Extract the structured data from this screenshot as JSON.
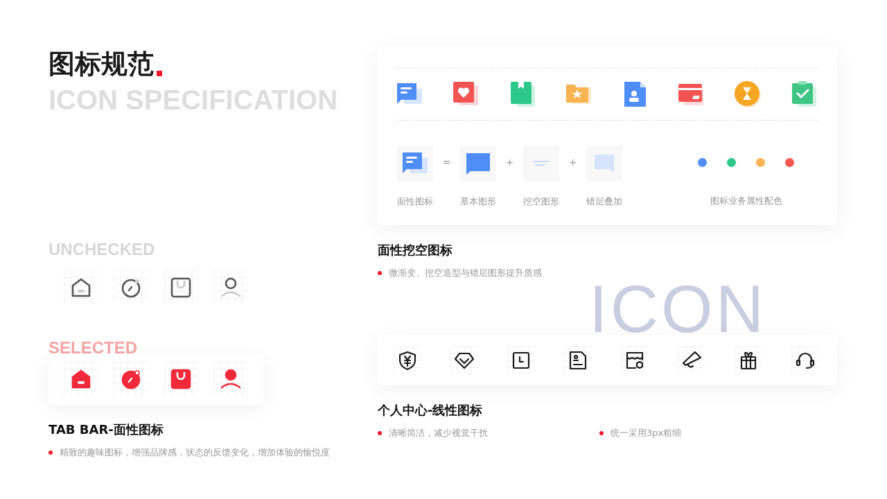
{
  "title": "图标规范",
  "title_subtitle": "ICON SPECIFICATION",
  "background_word": "ICON",
  "tabbar": {
    "rows": [
      {
        "label": "UNCHECKED",
        "selected": false
      },
      {
        "label": "SELECTED",
        "selected": true
      }
    ],
    "icons": [
      {
        "kind": "home"
      },
      {
        "kind": "compass"
      },
      {
        "kind": "bag"
      },
      {
        "kind": "user"
      }
    ],
    "heading": "TAB BAR-面性图标",
    "notes": [
      "精致的趣味图标，增强品牌感，状态的反馈变化，增加体验的愉悦度"
    ]
  },
  "face_icons": {
    "icons": [
      {
        "kind": "chat"
      },
      {
        "kind": "heart"
      },
      {
        "kind": "book"
      },
      {
        "kind": "folder"
      },
      {
        "kind": "contact"
      },
      {
        "kind": "card"
      },
      {
        "kind": "hourglass"
      },
      {
        "kind": "clipboard"
      }
    ],
    "composition": [
      {
        "kind": "full",
        "caption": "面性图标"
      },
      {
        "kind": "base",
        "caption": "基本图形",
        "operator": "="
      },
      {
        "kind": "cutout",
        "caption": "挖空图形",
        "operator": "+"
      },
      {
        "kind": "layer",
        "caption": "错层叠加",
        "operator": "+"
      }
    ],
    "palette": {
      "colors": [
        {
          "color": "#4f8ef7"
        },
        {
          "color": "#2ec98a"
        },
        {
          "color": "#f7b451"
        },
        {
          "color": "#f4574f"
        }
      ],
      "caption": "图标业务属性配色"
    },
    "heading": "面性挖空图标",
    "notes": [
      "微渐变、挖空造型与错层图形提升质感"
    ]
  },
  "line_icons": {
    "icons": [
      {
        "kind": "shield"
      },
      {
        "kind": "gem"
      },
      {
        "kind": "clock"
      },
      {
        "kind": "document"
      },
      {
        "kind": "shop"
      },
      {
        "kind": "megaphone"
      },
      {
        "kind": "gift"
      },
      {
        "kind": "headset"
      }
    ],
    "heading": "个人中心-线性图标",
    "notes": [
      "清晰简洁，减少视觉干扰",
      "统一采用3px粗细"
    ]
  }
}
